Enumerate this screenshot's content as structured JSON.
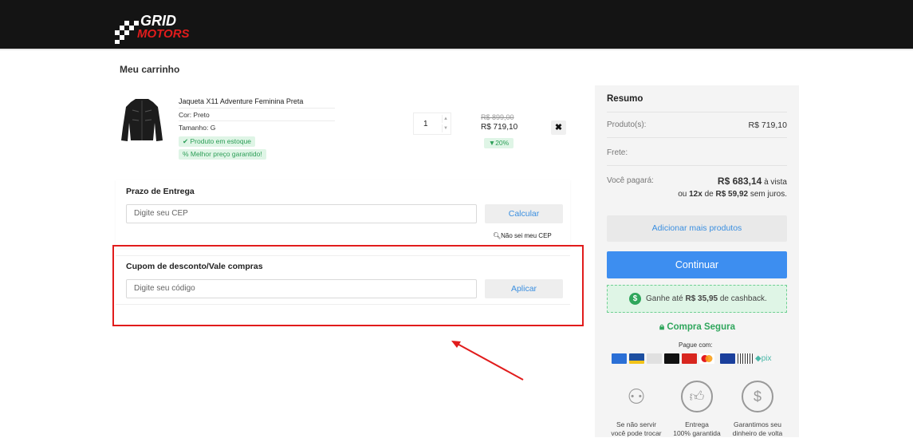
{
  "header": {
    "logo_alt": "GRID MOTORS"
  },
  "page_title": "Meu carrinho",
  "product": {
    "name": "Jaqueta X11 Adventure Feminina Preta",
    "color": "Cor: Preto",
    "size": "Tamanho: G",
    "stock_badge": "Produto em estoque",
    "best_price_badge": "Melhor preço garantido!",
    "quantity": "1",
    "price_old": "R$ 899,00",
    "price_new": "R$ 719,10",
    "discount": "20%",
    "remove_label": "✖"
  },
  "delivery": {
    "title": "Prazo de Entrega",
    "placeholder": "Digite seu CEP",
    "button": "Calcular",
    "dont_know_cep": "Não sei meu CEP"
  },
  "coupon": {
    "title": "Cupom de desconto/Vale compras",
    "placeholder": "Digite seu código",
    "button": "Aplicar"
  },
  "summary": {
    "title": "Resumo",
    "products_label": "Produto(s):",
    "products_value": "R$ 719,10",
    "freight_label": "Frete:",
    "pay_label": "Você pagará:",
    "pay_cash_amount": "R$ 683,14",
    "pay_cash_suffix": " à vista",
    "pay_installments_prefix": "ou ",
    "pay_installments_count": "12x",
    "pay_installments_mid": " de ",
    "pay_installments_value": "R$ 59,92",
    "pay_installments_suffix": " sem juros.",
    "add_more": "Adicionar mais produtos",
    "continue": "Continuar",
    "cashback_prefix": "Ganhe até ",
    "cashback_amount": "R$ 35,95",
    "cashback_suffix": " de cashback.",
    "secure": "Compra Segura",
    "pay_with": "Pague com:"
  },
  "guarantees": [
    {
      "line1": "Se não servir",
      "line2": "você pode trocar"
    },
    {
      "line1": "Entrega",
      "line2": "100% garantida"
    },
    {
      "line1": "Garantimos seu",
      "line2": "dinheiro de volta"
    }
  ],
  "colors": {
    "accent_blue": "#3d8ef0",
    "success_green": "#2fa65c",
    "annotation_red": "#e11c1c",
    "header_bg": "#141414"
  }
}
